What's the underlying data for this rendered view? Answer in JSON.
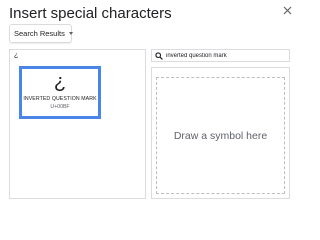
{
  "dialog": {
    "title": "Insert special characters",
    "close_icon": "close-icon"
  },
  "category": {
    "selected": "Search Results"
  },
  "results": {
    "current_glyph": "¿",
    "items": [
      {
        "glyph": "¿",
        "name": "INVERTED QUESTION MARK",
        "code": "U+00BF"
      }
    ]
  },
  "search": {
    "value": "inverted question mark",
    "icon": "search-icon"
  },
  "draw": {
    "hint": "Draw a symbol here"
  },
  "colors": {
    "selection_border": "#4a86e8",
    "panel_border": "#dadce0",
    "hint_text": "#5f6368"
  }
}
